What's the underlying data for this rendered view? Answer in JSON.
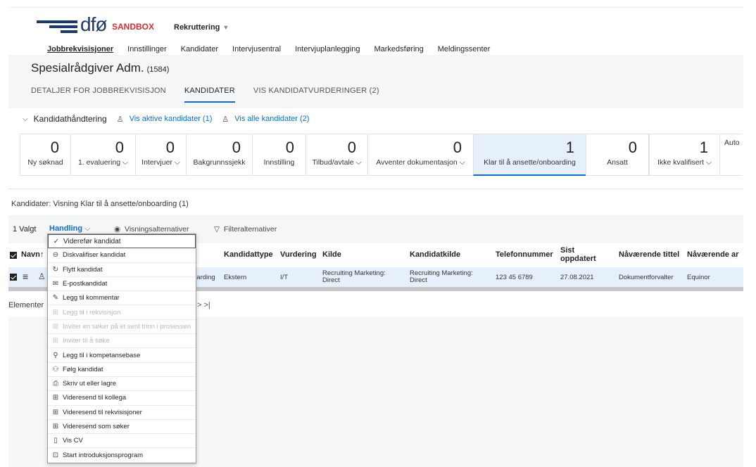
{
  "header": {
    "logo_text": "dfø",
    "sandbox_label": "SANDBOX",
    "app_name": "Rekruttering",
    "nav": [
      "Jobbrekvisisjoner",
      "Innstillinger",
      "Kandidater",
      "Intervjusentral",
      "Intervjuplanlegging",
      "Markedsføring",
      "Meldingssenter"
    ]
  },
  "page": {
    "title": "Spesialrådgiver Adm.",
    "req_id": "(1584)",
    "tabs": [
      "DETALJER FOR JOBBREKVISISJON",
      "KANDIDATER",
      "VIS KANDIDATVURDERINGER (2)"
    ]
  },
  "management": {
    "title": "Kandidathåndtering",
    "active_link": "Vis aktive kandidater (1)",
    "all_link": "Vis alle kandidater (2)"
  },
  "statuses": [
    {
      "count": "0",
      "label": "Ny søknad"
    },
    {
      "count": "0",
      "label": "1. evaluering ⌵"
    },
    {
      "count": "0",
      "label": "Intervjuer ⌵"
    },
    {
      "count": "0",
      "label": "Bakgrunnssjekk"
    },
    {
      "count": "0",
      "label": "Innstilling"
    },
    {
      "count": "0",
      "label": "Tilbud/avtale ⌵"
    },
    {
      "count": "0",
      "label": "Avventer dokumentasjon ⌵"
    },
    {
      "count": "1",
      "label": "Klar til å ansette/onboarding"
    },
    {
      "count": "0",
      "label": "Ansatt"
    }
  ],
  "statuses_right": [
    {
      "count": "1",
      "label": "Ikke kvalifisert ⌵"
    },
    {
      "count": "",
      "label": "Auto"
    }
  ],
  "view_info": "Kandidater: Visning Klar til å ansette/onboarding (1)",
  "toolbar": {
    "selected": "1 Valgt",
    "action": "Handling",
    "view_options": "Visningsalternativer",
    "filter_options": "Filteralternativer"
  },
  "grid": {
    "headers": {
      "name": "Navn",
      "candidate_type": "Kandidattype",
      "rating": "Vurdering",
      "source": "Kilde",
      "candidate_source": "Kandidatkilde",
      "phone": "Telefonnummer",
      "last_updated": "Sist oppdatert",
      "current_title": "Nåværende tittel",
      "current_employer": "Nåværende ar"
    },
    "row": {
      "status_partial": "oarding",
      "candidate_type": "Ekstern",
      "rating": "I/T",
      "source": "Recruiting Marketing: Direct",
      "candidate_source": "Recruiting Marketing: Direct",
      "phone": "123 45 6789",
      "last_updated": "27.08.2021",
      "current_title": "Dokumentforvalter",
      "current_employer": "Equinor"
    },
    "pager_label": "Elementer",
    "pager_arrows": "> >|"
  },
  "menu": [
    {
      "label": "Viderefør kandidat",
      "icon": "check-icon",
      "glyph": "✓",
      "disabled": false
    },
    {
      "label": "Diskvalifiser kandidat",
      "icon": "disqualify-icon",
      "glyph": "⊖",
      "disabled": false
    },
    {
      "label": "Flytt kandidat",
      "icon": "refresh-icon",
      "glyph": "↻",
      "disabled": false
    },
    {
      "label": "E-postkandidat",
      "icon": "email-icon",
      "glyph": "✉",
      "disabled": false
    },
    {
      "label": "Legg til kommentar",
      "icon": "comment-icon",
      "glyph": "✎",
      "disabled": false
    },
    {
      "label": "Legg til i rekvisisjon",
      "icon": "add-to-requisition-icon",
      "glyph": "⊞",
      "disabled": true
    },
    {
      "label": "Inviter en søker på et sent trinn i prosessen",
      "icon": "invite-icon",
      "glyph": "⊞",
      "disabled": true
    },
    {
      "label": "Inviter til å søke",
      "icon": "invite-apply-icon",
      "glyph": "⊞",
      "disabled": true
    },
    {
      "label": "Legg til i kompetansebase",
      "icon": "add-person-icon",
      "glyph": "⚲",
      "disabled": false
    },
    {
      "label": "Følg kandidat",
      "icon": "follow-icon",
      "glyph": "⚇",
      "disabled": false
    },
    {
      "label": "Skriv ut eller lagre",
      "icon": "print-icon",
      "glyph": "⎙",
      "disabled": false
    },
    {
      "label": "Videresend til kollega",
      "icon": "forward-icon",
      "glyph": "⊞",
      "disabled": false
    },
    {
      "label": "Videresend til rekvisisjoner",
      "icon": "forward-requisition-icon",
      "glyph": "⊞",
      "disabled": false
    },
    {
      "label": "Videresend som søker",
      "icon": "forward-applicant-icon",
      "glyph": "⊞",
      "disabled": false
    },
    {
      "label": "Vis CV",
      "icon": "document-icon",
      "glyph": "▯",
      "disabled": false
    },
    {
      "label": "Start introduksjonsprogram",
      "icon": "onboarding-icon",
      "glyph": "⊡",
      "disabled": false
    }
  ],
  "colors": {
    "brand": "#1b3a6b",
    "sandbox": "#d32f2f",
    "link": "#0a6ed1",
    "selection": "#e5f0fa"
  }
}
